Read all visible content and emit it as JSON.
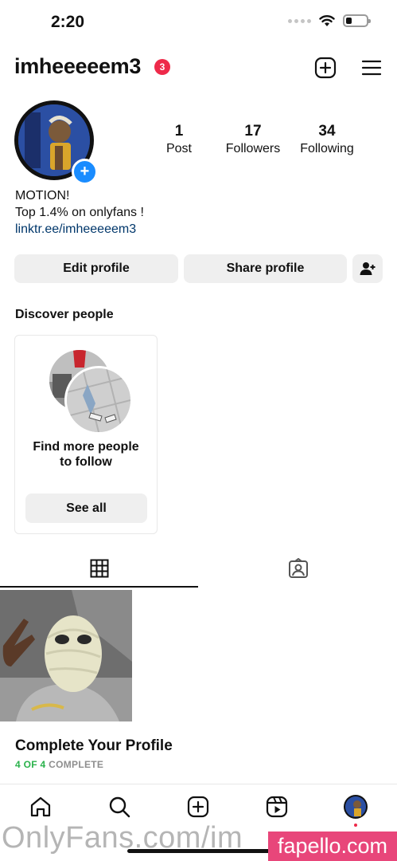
{
  "status_bar": {
    "time": "2:20"
  },
  "header": {
    "username": "imheeeeem3",
    "notification_count": "3"
  },
  "profile": {
    "stats": [
      {
        "value": "1",
        "label": "Post"
      },
      {
        "value": "17",
        "label": "Followers"
      },
      {
        "value": "34",
        "label": "Following"
      }
    ],
    "bio": {
      "name": "MOTION!",
      "line": "Top 1.4% on onlyfans !",
      "link": "linktr.ee/imheeeeem3"
    }
  },
  "actions": {
    "edit_label": "Edit profile",
    "share_label": "Share profile"
  },
  "discover": {
    "title": "Discover people",
    "card_text_line1": "Find more people",
    "card_text_line2": "to follow",
    "see_all_label": "See all"
  },
  "complete_profile": {
    "title": "Complete Your Profile",
    "progress": "4 OF 4",
    "status": "COMPLETE"
  },
  "watermarks": {
    "left": "OnlyFans.com/im",
    "right": "fapello.com"
  },
  "colors": {
    "accent_blue": "#1a8cff",
    "badge_red": "#ee2a4a",
    "link_blue": "#00376b",
    "complete_green": "#2bb24c",
    "watermark_pink": "#e8467a"
  },
  "icons": [
    "signal-dots-icon",
    "wifi-icon",
    "battery-icon",
    "new-post-icon",
    "menu-icon",
    "add-person-icon",
    "grid-icon",
    "tagged-icon",
    "home-icon",
    "search-icon",
    "create-icon",
    "reels-icon"
  ]
}
